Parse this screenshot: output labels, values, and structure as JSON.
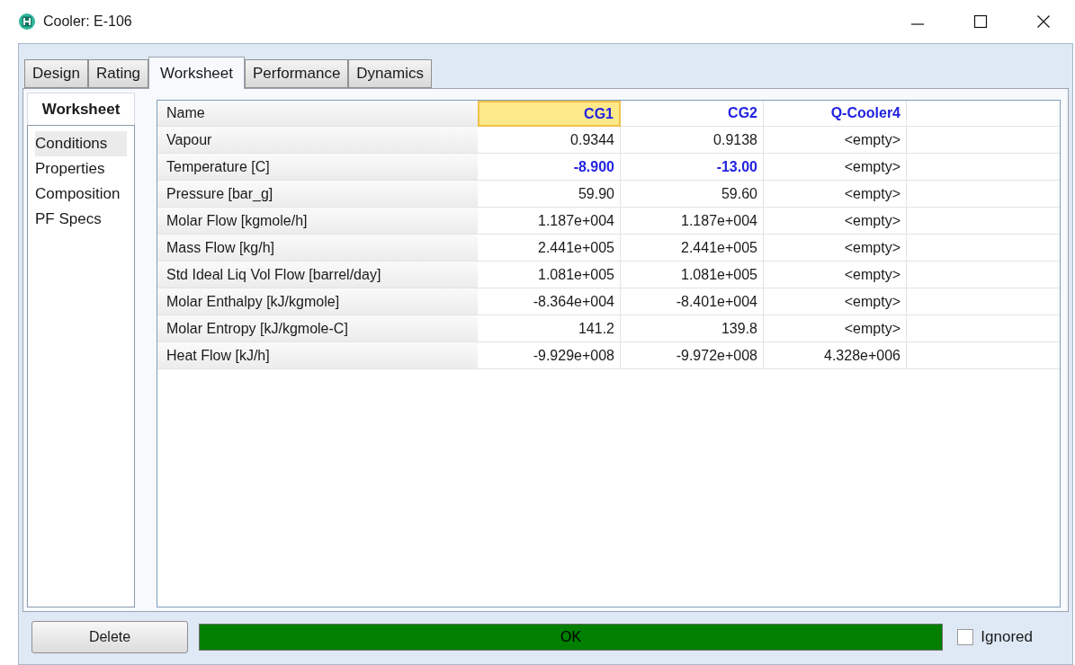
{
  "window": {
    "title": "Cooler: E-106"
  },
  "tabs": [
    {
      "label": "Design",
      "selected": false
    },
    {
      "label": "Rating",
      "selected": false
    },
    {
      "label": "Worksheet",
      "selected": true
    },
    {
      "label": "Performance",
      "selected": false
    },
    {
      "label": "Dynamics",
      "selected": false
    }
  ],
  "side_nav": {
    "title": "Worksheet",
    "items": [
      {
        "label": "Conditions",
        "selected": true
      },
      {
        "label": "Properties",
        "selected": false
      },
      {
        "label": "Composition",
        "selected": false
      },
      {
        "label": "PF Specs",
        "selected": false
      }
    ]
  },
  "table": {
    "name_header": "Name",
    "columns": [
      {
        "label": "CG1",
        "selected": true
      },
      {
        "label": "CG2",
        "selected": false
      },
      {
        "label": "Q-Cooler4",
        "selected": false
      }
    ],
    "rows": [
      {
        "label": "Vapour",
        "cells": [
          {
            "text": "0.9344",
            "specified": false
          },
          {
            "text": "0.9138",
            "specified": false
          },
          {
            "text": "<empty>",
            "specified": false
          }
        ]
      },
      {
        "label": "Temperature [C]",
        "cells": [
          {
            "text": "-8.900",
            "specified": true
          },
          {
            "text": "-13.00",
            "specified": true
          },
          {
            "text": "<empty>",
            "specified": false
          }
        ]
      },
      {
        "label": "Pressure [bar_g]",
        "cells": [
          {
            "text": "59.90",
            "specified": false
          },
          {
            "text": "59.60",
            "specified": false
          },
          {
            "text": "<empty>",
            "specified": false
          }
        ]
      },
      {
        "label": "Molar Flow [kgmole/h]",
        "cells": [
          {
            "text": "1.187e+004",
            "specified": false
          },
          {
            "text": "1.187e+004",
            "specified": false
          },
          {
            "text": "<empty>",
            "specified": false
          }
        ]
      },
      {
        "label": "Mass Flow [kg/h]",
        "cells": [
          {
            "text": "2.441e+005",
            "specified": false
          },
          {
            "text": "2.441e+005",
            "specified": false
          },
          {
            "text": "<empty>",
            "specified": false
          }
        ]
      },
      {
        "label": "Std Ideal Liq Vol Flow [barrel/day]",
        "cells": [
          {
            "text": "1.081e+005",
            "specified": false
          },
          {
            "text": "1.081e+005",
            "specified": false
          },
          {
            "text": "<empty>",
            "specified": false
          }
        ]
      },
      {
        "label": "Molar Enthalpy [kJ/kgmole]",
        "cells": [
          {
            "text": "-8.364e+004",
            "specified": false
          },
          {
            "text": "-8.401e+004",
            "specified": false
          },
          {
            "text": "<empty>",
            "specified": false
          }
        ]
      },
      {
        "label": "Molar Entropy [kJ/kgmole-C]",
        "cells": [
          {
            "text": "141.2",
            "specified": false
          },
          {
            "text": "139.8",
            "specified": false
          },
          {
            "text": "<empty>",
            "specified": false
          }
        ]
      },
      {
        "label": "Heat Flow [kJ/h]",
        "cells": [
          {
            "text": "-9.929e+008",
            "specified": false
          },
          {
            "text": "-9.972e+008",
            "specified": false
          },
          {
            "text": "4.328e+006",
            "specified": false
          }
        ]
      }
    ]
  },
  "footer": {
    "delete_button": "Delete",
    "status": "OK",
    "ignored": {
      "label": "Ignored",
      "checked": false
    }
  }
}
